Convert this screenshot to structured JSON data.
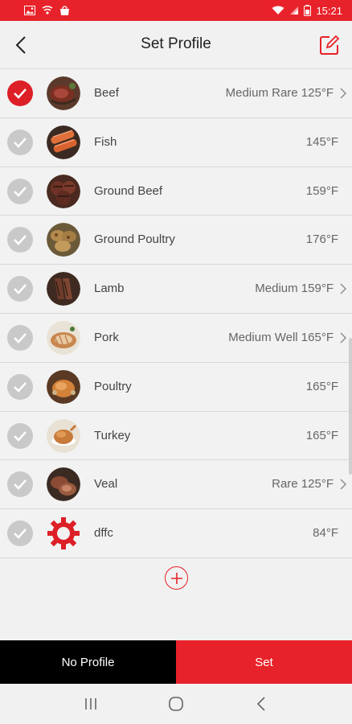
{
  "status_bar": {
    "time": "15:21",
    "left_icons": [
      "image-icon",
      "cast-icon",
      "store-icon"
    ],
    "right_icons": [
      "wifi-icon",
      "signal-icon",
      "battery-icon"
    ]
  },
  "header": {
    "title": "Set Profile",
    "back_icon": "back-arrow-icon",
    "edit_icon": "edit-icon"
  },
  "profiles": [
    {
      "name": "Beef",
      "value": "Medium Rare 125°F",
      "selected": true,
      "chevron": true,
      "thumb": "beef"
    },
    {
      "name": "Fish",
      "value": "145°F",
      "selected": false,
      "chevron": false,
      "thumb": "fish"
    },
    {
      "name": "Ground Beef",
      "value": "159°F",
      "selected": false,
      "chevron": false,
      "thumb": "ground-beef"
    },
    {
      "name": "Ground Poultry",
      "value": "176°F",
      "selected": false,
      "chevron": false,
      "thumb": "ground-poultry"
    },
    {
      "name": "Lamb",
      "value": "Medium 159°F",
      "selected": false,
      "chevron": true,
      "thumb": "lamb"
    },
    {
      "name": "Pork",
      "value": "Medium Well 165°F",
      "selected": false,
      "chevron": true,
      "thumb": "pork"
    },
    {
      "name": "Poultry",
      "value": "165°F",
      "selected": false,
      "chevron": false,
      "thumb": "poultry"
    },
    {
      "name": "Turkey",
      "value": "165°F",
      "selected": false,
      "chevron": false,
      "thumb": "turkey"
    },
    {
      "name": "Veal",
      "value": "Rare 125°F",
      "selected": false,
      "chevron": true,
      "thumb": "veal"
    },
    {
      "name": "dffc",
      "value": "84°F",
      "selected": false,
      "chevron": false,
      "thumb": "custom-gear"
    }
  ],
  "add_button_icon": "add-icon",
  "bottom": {
    "no_profile_label": "No Profile",
    "set_label": "Set"
  },
  "nav": [
    "recent-apps-icon",
    "home-icon",
    "back-icon"
  ],
  "colors": {
    "accent": "#e8222a",
    "check_selected": "#dd1f27",
    "check_unselected": "#c9c9c9",
    "background": "#f1f1f1"
  }
}
